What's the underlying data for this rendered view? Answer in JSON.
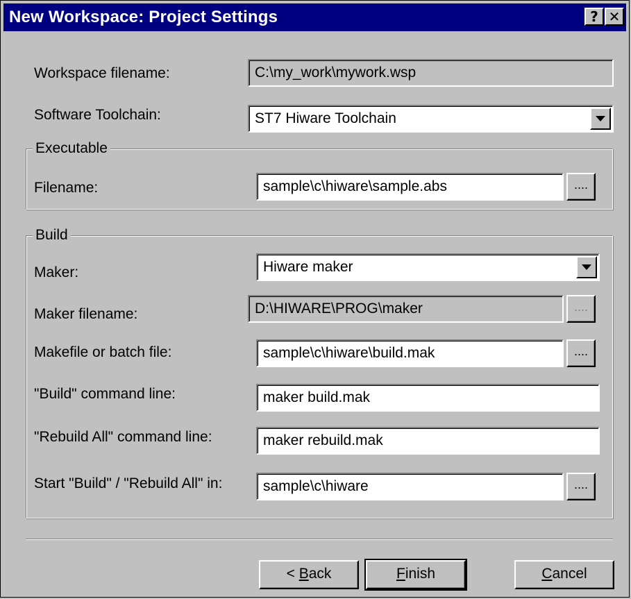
{
  "window": {
    "title": "New Workspace: Project Settings",
    "help_button": "?",
    "close_button": "✕"
  },
  "workspace": {
    "label": "Workspace filename:",
    "value": "C:\\my_work\\mywork.wsp"
  },
  "toolchain": {
    "label": "Software Toolchain:",
    "value": "ST7 Hiware Toolchain"
  },
  "executable": {
    "group_title": "Executable",
    "filename_label": "Filename:",
    "filename_value": "sample\\c\\hiware\\sample.abs",
    "browse": "...."
  },
  "build": {
    "group_title": "Build",
    "maker_label": "Maker:",
    "maker_value": "Hiware maker",
    "maker_filename_label": "Maker filename:",
    "maker_filename_value": "D:\\HIWARE\\PROG\\maker",
    "makefile_label": "Makefile or batch file:",
    "makefile_value": "sample\\c\\hiware\\build.mak",
    "build_cmd_label": "\"Build\" command line:",
    "build_cmd_value": "maker build.mak",
    "rebuild_cmd_label": "\"Rebuild All\" command line:",
    "rebuild_cmd_value": "maker rebuild.mak",
    "start_in_label": "Start \"Build\" / \"Rebuild All\" in:",
    "start_in_value": "sample\\c\\hiware",
    "browse": "...."
  },
  "buttons": {
    "back_prefix": "< ",
    "back_accel": "B",
    "back_rest": "ack",
    "finish_accel": "F",
    "finish_rest": "inish",
    "cancel_accel": "C",
    "cancel_rest": "ancel"
  },
  "icons": {
    "dropdown": "chevron-down-icon"
  }
}
